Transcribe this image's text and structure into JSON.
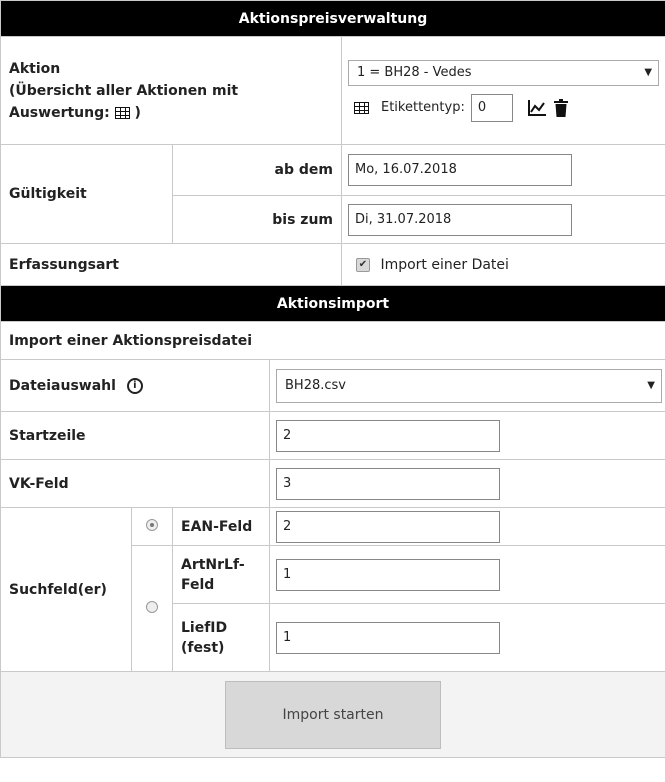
{
  "section1": {
    "title": "Aktionspreisverwaltung",
    "aktion_label_line1": "Aktion",
    "aktion_label_line2": "(Übersicht aller Aktionen mit",
    "aktion_label_line3": "Auswertung:",
    "aktion_label_close": ")",
    "aktion_value": "1 = BH28 - Vedes",
    "etikettentyp_label": "Etikettentyp:",
    "etikettentyp_value": "0",
    "gueltigkeit_label": "Gültigkeit",
    "ab_dem_label": "ab dem",
    "ab_dem_value": "Mo, 16.07.2018",
    "bis_zum_label": "bis zum",
    "bis_zum_value": "Di, 31.07.2018",
    "erfassungsart_label": "Erfassungsart",
    "erfassungsart_option": "Import einer Datei"
  },
  "section2": {
    "title": "Aktionsimport",
    "subtitle": "Import einer Aktionspreisdatei",
    "dateiauswahl_label": "Dateiauswahl",
    "dateiauswahl_value": "BH28.csv",
    "startzeile_label": "Startzeile",
    "startzeile_value": "2",
    "vkfeld_label": "VK-Feld",
    "vkfeld_value": "3",
    "suchfelder_label": "Suchfeld(er)",
    "ean_label": "EAN-Feld",
    "ean_value": "2",
    "artnr_label_1": "ArtNrLf-",
    "artnr_label_2": "Feld",
    "artnr_value": "1",
    "liefid_label_1": "LiefID",
    "liefid_label_2": "(fest)",
    "liefid_value": "1",
    "import_button": "Import starten"
  }
}
